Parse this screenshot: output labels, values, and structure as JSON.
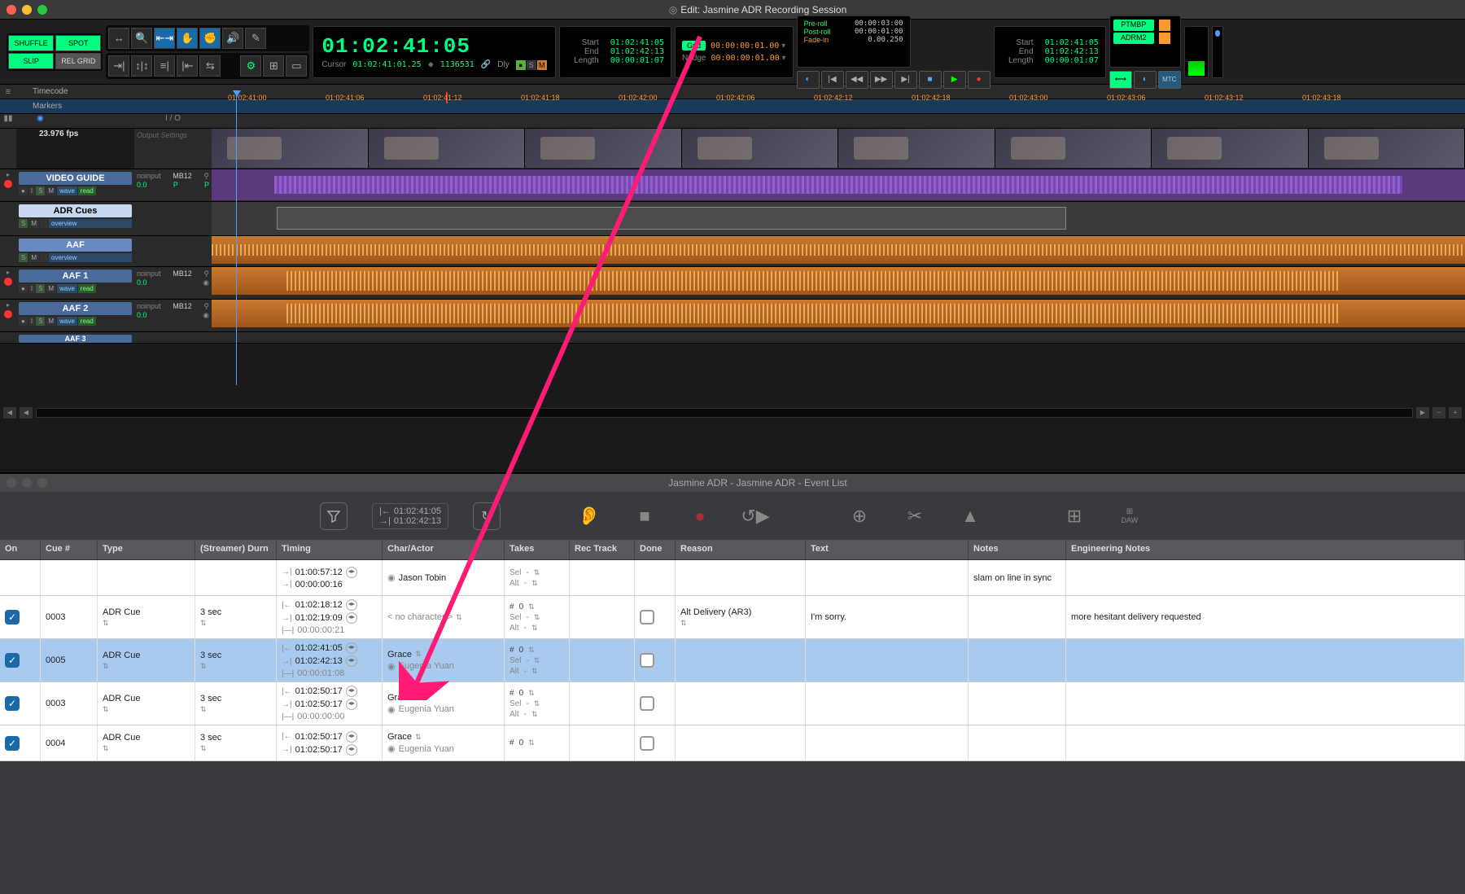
{
  "window": {
    "title": "Edit: Jasmine ADR Recording Session"
  },
  "modes": {
    "shuffle": "SHUFFLE",
    "spot": "SPOT",
    "slip": "SLIP",
    "relgrid": "REL GRID"
  },
  "counter": {
    "main": "01:02:41:05",
    "cursor_label": "Cursor",
    "cursor_val": "01:02:41:01.25",
    "samples": "1136531",
    "dly": "Dly"
  },
  "selection": {
    "start_label": "Start",
    "start": "01:02:41:05",
    "end_label": "End",
    "end": "01:02:42:13",
    "length_label": "Length",
    "length": "00:00:01:07"
  },
  "grid": {
    "label": "Grid",
    "val": "00:00:00:01.00",
    "nudge_label": "Nudge",
    "nudge_val": "00:00:00:01.00"
  },
  "roll": {
    "preroll": "Pre-roll",
    "preroll_val": "00:00:03:00",
    "postroll": "Post-roll",
    "postroll_val": "00:00:01:00",
    "fadein": "Fade-in",
    "fadein_val": "0.00.250"
  },
  "sel2": {
    "start": "01:02:41:05",
    "end": "01:02:42:13",
    "length": "00:00:01:07"
  },
  "ptm": {
    "b1": "PTMBP",
    "b2": "ADRM2",
    "mtc": "MTC"
  },
  "ruler": {
    "timecode": "Timecode",
    "markers": "Markers",
    "ticks": [
      "01:02:41:00",
      "01:02:41:06",
      "01:02:41:12",
      "01:02:41:18",
      "01:02:42:00",
      "01:02:42:06",
      "01:02:42:12",
      "01:02:42:18",
      "01:02:43:00",
      "01:02:43:06",
      "01:02:43:12",
      "01:02:43:18"
    ]
  },
  "track_hdrs": {
    "bars": "▮▮▮",
    "io": "I / O",
    "out": "Output Settings",
    "fps": "23.976 fps"
  },
  "tracks": [
    {
      "name": "VIDEO GUIDE",
      "io_in": "noinput",
      "io_bus": "MB12",
      "gain": "0.0",
      "p": "P"
    },
    {
      "name": "ADR Cues",
      "overview": "overview"
    },
    {
      "name": "AAF",
      "overview": "overview"
    },
    {
      "name": "AAF 1",
      "io_in": "noinput",
      "io_bus": "MB12",
      "gain": "0.0"
    },
    {
      "name": "AAF 2",
      "io_in": "noinput",
      "io_bus": "MB12",
      "gain": "0.0"
    },
    {
      "name": "AAF 3"
    }
  ],
  "track_flags": {
    "i": "I",
    "s": "S",
    "m": "M",
    "wave": "wave",
    "read": "read",
    "dot": "●"
  },
  "evt_window": {
    "title": "Jasmine ADR - Jasmine ADR - Event List"
  },
  "evt_toolbar_tc": {
    "in": "01:02:41:05",
    "out": "01:02:42:13"
  },
  "evt_toolbar_daw": "DAW",
  "evt_columns": [
    "On",
    "Cue #",
    "Type",
    "(Streamer) Durn",
    "Timing",
    "Char/Actor",
    "Takes",
    "Rec Track",
    "Done",
    "Reason",
    "Text",
    "Notes",
    "Engineering Notes"
  ],
  "evt_rows": [
    {
      "on": false,
      "cue": "",
      "type": "",
      "durn": "",
      "t1": "01:00:57:12",
      "t2": "00:00:00:16",
      "char": "Jason Tobin",
      "nochar": false,
      "tk_num": "",
      "tk_sel": "-",
      "tk_alt": "-",
      "done": false,
      "reason": "",
      "text": "",
      "notes": "slam on line in sync",
      "eng": ""
    },
    {
      "on": true,
      "cue": "0003",
      "type": "ADR Cue",
      "durn": "3 sec",
      "t1": "01:02:18:12",
      "t2": "01:02:19:09",
      "t3": "00:00:00:21",
      "char": "",
      "nochar": true,
      "tk_num": "0",
      "tk_sel": "-",
      "tk_alt": "-",
      "done": false,
      "reason": "Alt Delivery (AR3)",
      "text": "I'm sorry.",
      "notes": "",
      "eng": "more hesitant delivery requested"
    },
    {
      "on": true,
      "cue": "0005",
      "type": "ADR Cue",
      "durn": "3 sec",
      "t1": "01:02:41:05",
      "t2": "01:02:42:13",
      "t3": "00:00:01:08",
      "char": "Grace",
      "actor": "Eugenia Yuan",
      "tk_num": "0",
      "tk_sel": "-",
      "tk_alt": "-",
      "done": false,
      "reason": "",
      "text": "",
      "notes": "",
      "eng": "",
      "selected": true
    },
    {
      "on": true,
      "cue": "0003",
      "type": "ADR Cue",
      "durn": "3 sec",
      "t1": "01:02:50:17",
      "t2": "01:02:50:17",
      "t3": "00:00:00:00",
      "char": "Grace",
      "actor": "Eugenia Yuan",
      "tk_num": "0",
      "tk_sel": "-",
      "tk_alt": "-",
      "done": false,
      "reason": "",
      "text": "",
      "notes": "",
      "eng": ""
    },
    {
      "on": true,
      "cue": "0004",
      "type": "ADR Cue",
      "durn": "3 sec",
      "t1": "01:02:50:17",
      "t2": "01:02:50:17",
      "char": "Grace",
      "actor": "Eugenia Yuan",
      "tk_num": "0",
      "done": false,
      "reason": "",
      "text": "",
      "notes": "",
      "eng": ""
    }
  ],
  "labels": {
    "nochar": "< no character >",
    "sel": "Sel",
    "alt": "Alt",
    "hash": "#",
    "t_in": "|←",
    "t_out": "→|",
    "t_dur": "|—|"
  }
}
